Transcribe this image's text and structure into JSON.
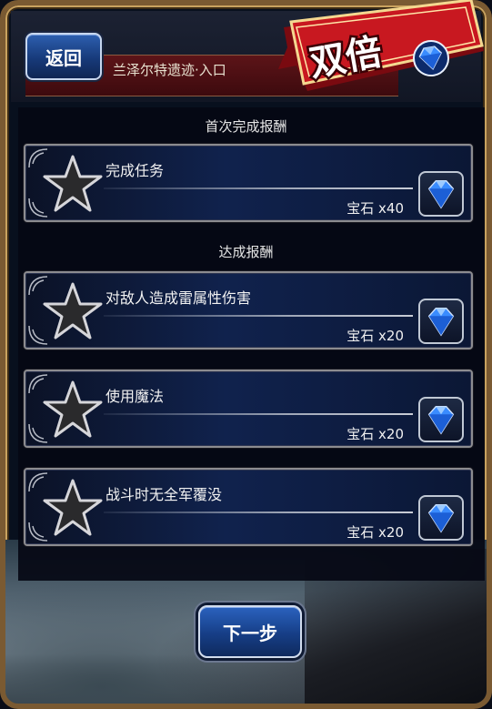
{
  "header": {
    "back_label": "返回",
    "location_title": "兰泽尔特遗迹·入口"
  },
  "banner": {
    "text": "双倍"
  },
  "sections": {
    "first_clear_title": "首次完成报酬",
    "achievement_title": "达成报酬"
  },
  "missions": [
    {
      "label": "完成任务",
      "reward": "宝石 x40"
    },
    {
      "label": "对敌人造成雷属性伤害",
      "reward": "宝石 x20"
    },
    {
      "label": "使用魔法",
      "reward": "宝石 x20"
    },
    {
      "label": "战斗时无全军覆没",
      "reward": "宝石 x20"
    }
  ],
  "footer": {
    "next_label": "下一步"
  },
  "colors": {
    "banner_red": "#c81820",
    "button_blue": "#1f4fa0",
    "gem_blue": "#3a8cff"
  },
  "icons": {
    "star": "star-icon",
    "gem": "gem-icon"
  }
}
